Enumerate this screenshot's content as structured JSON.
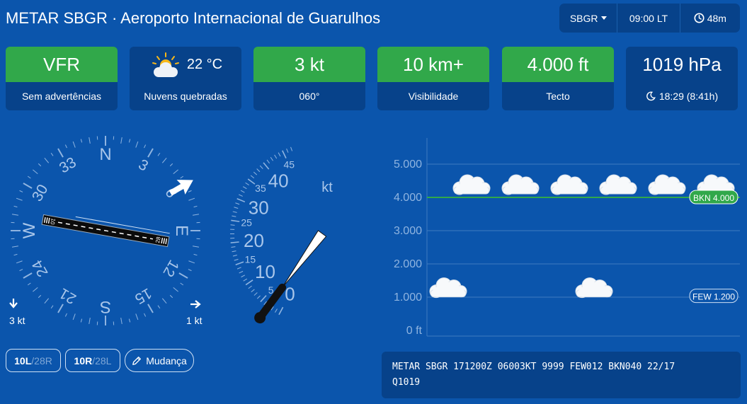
{
  "header": {
    "title": "METAR SBGR · Aeroporto Internacional de Guarulhos"
  },
  "topbar": {
    "station": "SBGR",
    "time": "09:00 LT",
    "age": "48m"
  },
  "cards": {
    "flight_rules": {
      "value": "VFR",
      "label": "Sem advertências",
      "color": "#31a84a"
    },
    "weather": {
      "temp": "22 °C",
      "label": "Nuvens quebradas",
      "icon": "sun-cloud-icon"
    },
    "wind": {
      "value": "3 kt",
      "label": "060°",
      "color": "#31a84a"
    },
    "visibility": {
      "value": "10 km+",
      "label": "Visibilidade",
      "color": "#31a84a"
    },
    "ceiling": {
      "value": "4.000 ft",
      "label": "Tecto",
      "color": "#31a84a"
    },
    "pressure": {
      "value": "1019 hPa",
      "sunset": "18:29 (8:41h)",
      "icon": "moon-icon"
    }
  },
  "compass": {
    "cardinals": {
      "n": "N",
      "e": "E",
      "s": "S",
      "w": "W"
    },
    "labels": {
      "n3": "3",
      "n6": "6",
      "n12": "12",
      "n15": "15",
      "n21": "21",
      "n24": "24",
      "n30": "30",
      "n33": "33"
    },
    "wind_direction_deg": 60,
    "runway_heading_deg": 100,
    "runway_end_a": "10",
    "runway_end_b": "28",
    "crosswind_left": "3 kt",
    "crosswind_right": "1 kt"
  },
  "speed_gauge": {
    "unit": "kt",
    "major": [
      "0",
      "10",
      "20",
      "30",
      "40"
    ],
    "minor": [
      "5",
      "15",
      "25",
      "35",
      "45"
    ],
    "value_kt": 3
  },
  "runway_buttons": [
    {
      "active": "10L",
      "other": "/28R"
    },
    {
      "active": "10R",
      "other": "/28L"
    }
  ],
  "change_button": {
    "label": "Mudança"
  },
  "chart_data": {
    "type": "scatter",
    "yticks": [
      "5.000",
      "4.000",
      "3.000",
      "2.000",
      "1.000",
      "0 ft"
    ],
    "ylim": [
      0,
      5000
    ],
    "layers": [
      {
        "name": "BKN 4.000",
        "altitude_ft": 4000,
        "cover": "BKN"
      },
      {
        "name": "FEW 1.200",
        "altitude_ft": 1200,
        "cover": "FEW"
      }
    ],
    "ceiling_color": "#31a84a"
  },
  "metar": {
    "line1": "METAR SBGR 171200Z 06003KT 9999 FEW012 BKN040 22/17",
    "line2": "Q1019"
  }
}
